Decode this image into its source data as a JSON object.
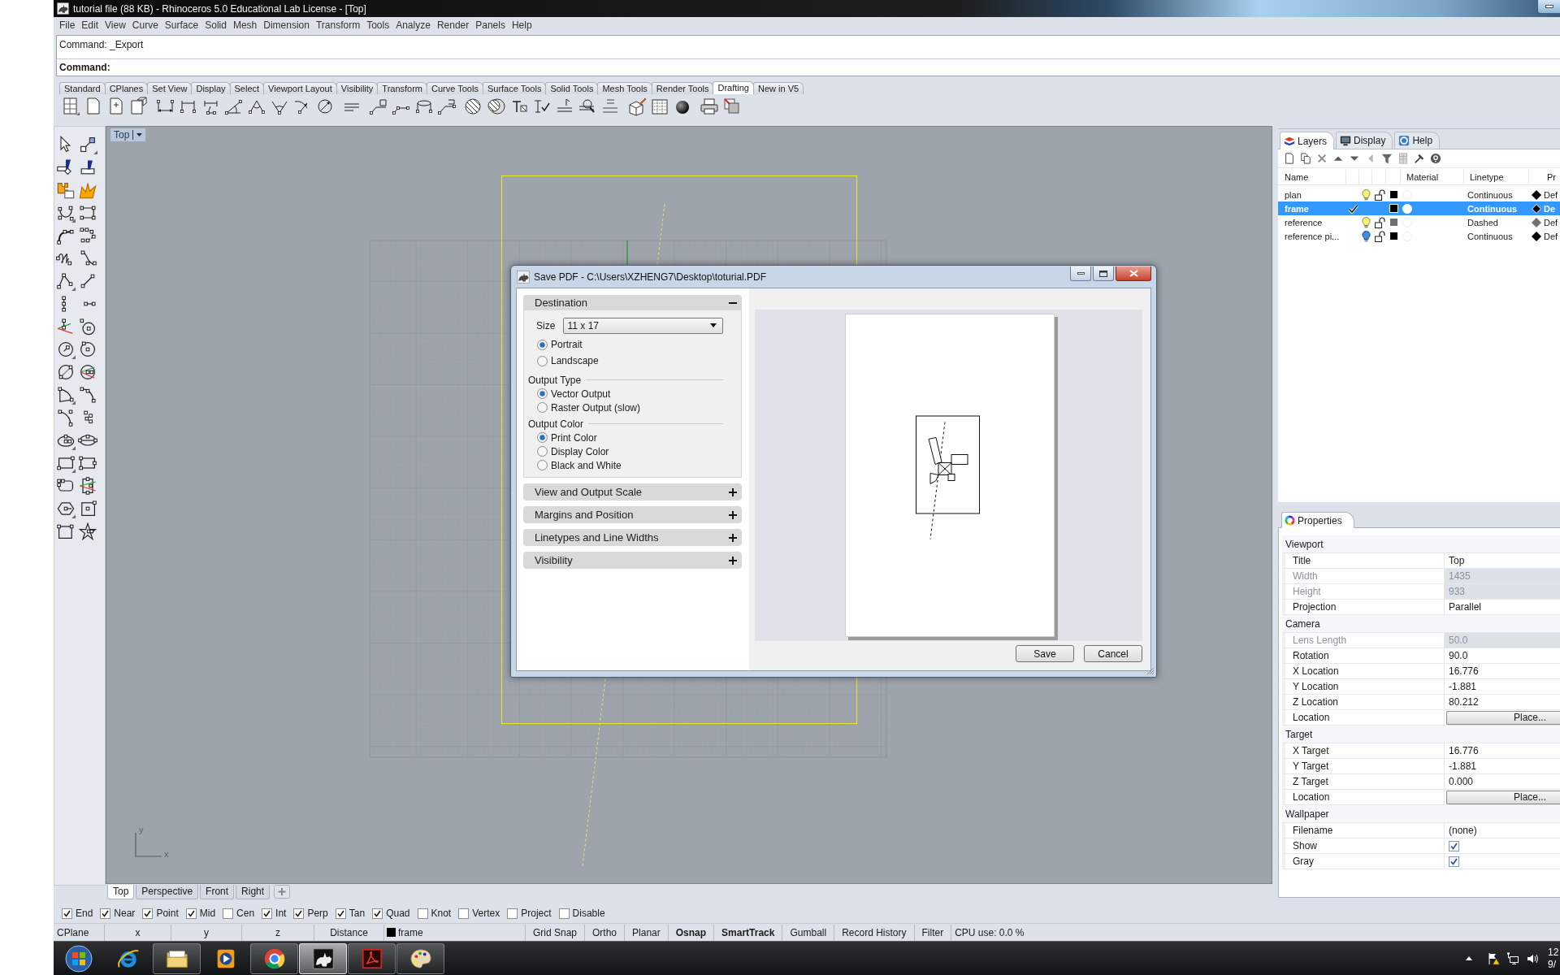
{
  "window": {
    "title": "tutorial file (88 KB) - Rhinoceros 5.0 Educational Lab License - [Top]"
  },
  "menu": [
    "File",
    "Edit",
    "View",
    "Curve",
    "Surface",
    "Solid",
    "Mesh",
    "Dimension",
    "Transform",
    "Tools",
    "Analyze",
    "Render",
    "Panels",
    "Help"
  ],
  "command": {
    "history": "Command: _Export",
    "prompt": "Command:"
  },
  "toolbar_tabs": [
    {
      "label": "Standard",
      "selected": false
    },
    {
      "label": "CPlanes",
      "selected": false
    },
    {
      "label": "Set View",
      "selected": false
    },
    {
      "label": "Display",
      "selected": false
    },
    {
      "label": "Select",
      "selected": false
    },
    {
      "label": "Viewport Layout",
      "selected": false
    },
    {
      "label": "Visibility",
      "selected": false
    },
    {
      "label": "Transform",
      "selected": false
    },
    {
      "label": "Curve Tools",
      "selected": false
    },
    {
      "label": "Surface Tools",
      "selected": false
    },
    {
      "label": "Solid Tools",
      "selected": false
    },
    {
      "label": "Mesh Tools",
      "selected": false
    },
    {
      "label": "Render Tools",
      "selected": false
    },
    {
      "label": "Drafting",
      "selected": true
    },
    {
      "label": "New in V5",
      "selected": false
    }
  ],
  "viewport": {
    "title": "Top",
    "axis_y": "y",
    "axis_x": "x"
  },
  "viewport_tabs": [
    {
      "label": "Top",
      "selected": true
    },
    {
      "label": "Perspective",
      "selected": false
    },
    {
      "label": "Front",
      "selected": false
    },
    {
      "label": "Right",
      "selected": false
    }
  ],
  "osnaps": [
    {
      "label": "End",
      "checked": true
    },
    {
      "label": "Near",
      "checked": true
    },
    {
      "label": "Point",
      "checked": true
    },
    {
      "label": "Mid",
      "checked": true
    },
    {
      "label": "Cen",
      "checked": false
    },
    {
      "label": "Int",
      "checked": true
    },
    {
      "label": "Perp",
      "checked": true
    },
    {
      "label": "Tan",
      "checked": true
    },
    {
      "label": "Quad",
      "checked": true
    },
    {
      "label": "Knot",
      "checked": false
    },
    {
      "label": "Vertex",
      "checked": false
    },
    {
      "label": "Project",
      "checked": false
    },
    {
      "label": "Disable",
      "checked": false
    }
  ],
  "status_bar": {
    "cells": [
      "CPlane",
      "x",
      "y",
      "z",
      "Distance"
    ],
    "layer": {
      "name": "frame",
      "color": "#000000"
    },
    "toggles": [
      {
        "label": "Grid Snap",
        "on": false
      },
      {
        "label": "Ortho",
        "on": false
      },
      {
        "label": "Planar",
        "on": false
      },
      {
        "label": "Osnap",
        "on": true
      },
      {
        "label": "SmartTrack",
        "on": true
      },
      {
        "label": "Gumball",
        "on": false
      },
      {
        "label": "Record History",
        "on": false
      }
    ],
    "filter": "Filter",
    "cpu": "CPU use: 0.0 %"
  },
  "dialog": {
    "title": "Save PDF - C:\\Users\\XZHENG7\\Desktop\\toturial.PDF",
    "sections": [
      {
        "title": "Destination",
        "expanded": true,
        "size": {
          "label": "Size",
          "value": "11 x 17"
        },
        "orientation": [
          {
            "label": "Portrait",
            "selected": true
          },
          {
            "label": "Landscape",
            "selected": false
          }
        ],
        "groups": [
          {
            "title": "Output Type",
            "options": [
              {
                "label": "Vector Output",
                "selected": true
              },
              {
                "label": "Raster Output (slow)",
                "selected": false
              }
            ]
          },
          {
            "title": "Output Color",
            "options": [
              {
                "label": "Print Color",
                "selected": true
              },
              {
                "label": "Display Color",
                "selected": false
              },
              {
                "label": "Black and White",
                "selected": false
              }
            ]
          }
        ]
      },
      {
        "title": "View and Output Scale",
        "expanded": false
      },
      {
        "title": "Margins and Position",
        "expanded": false
      },
      {
        "title": "Linetypes and Line Widths",
        "expanded": false
      },
      {
        "title": "Visibility",
        "expanded": false
      }
    ],
    "buttons": [
      "Save",
      "Cancel"
    ]
  },
  "layers_panel": {
    "tabs": [
      {
        "label": "Layers",
        "selected": true
      },
      {
        "label": "Display",
        "selected": false
      },
      {
        "label": "Help",
        "selected": false
      }
    ],
    "columns": [
      "Name",
      "Material",
      "Linetype",
      "Pr"
    ],
    "rows": [
      {
        "name": "plan",
        "selected": false,
        "current": false,
        "on": true,
        "locked": false,
        "color": "#000000",
        "linetype": "Continuous",
        "diamond": {
          "color": "#000000"
        },
        "column_9": "Def"
      },
      {
        "name": "frame",
        "selected": true,
        "current": true,
        "color": "#000000",
        "linetype": "Continuous",
        "diamond": {
          "color": "#000000"
        },
        "column_9": "De"
      },
      {
        "name": "reference",
        "selected": false,
        "current": false,
        "on": true,
        "locked": false,
        "color": "#707070",
        "linetype": "Dashed",
        "diamond": {
          "color": "#707070"
        },
        "column_9": "Def"
      },
      {
        "name": "reference pi...",
        "selected": false,
        "current": false,
        "on": false,
        "locked": false,
        "color": "#000000",
        "linetype": "Continuous",
        "diamond": {
          "color": "#000000"
        },
        "column_9": "Def"
      }
    ]
  },
  "properties_panel": {
    "tab": "Properties",
    "groups": [
      {
        "title": "Viewport",
        "rows": [
          {
            "label": "Title",
            "value": "Top",
            "kind": "text",
            "disabled": false
          },
          {
            "label": "Width",
            "value": "1435",
            "kind": "text",
            "disabled": true
          },
          {
            "label": "Height",
            "value": "933",
            "kind": "text",
            "disabled": true
          },
          {
            "label": "Projection",
            "value": "Parallel",
            "kind": "text",
            "disabled": false
          }
        ]
      },
      {
        "title": "Camera",
        "rows": [
          {
            "label": "Lens Length",
            "value": "50.0",
            "kind": "text",
            "disabled": true
          },
          {
            "label": "Rotation",
            "value": "90.0",
            "kind": "text",
            "disabled": false
          },
          {
            "label": "X Location",
            "value": "16.776",
            "kind": "text",
            "disabled": false
          },
          {
            "label": "Y Location",
            "value": "-1.881",
            "kind": "text",
            "disabled": false
          },
          {
            "label": "Z Location",
            "value": "80.212",
            "kind": "text",
            "disabled": false
          },
          {
            "label": "Location",
            "value": "Place...",
            "kind": "button",
            "disabled": false
          }
        ]
      },
      {
        "title": "Target",
        "rows": [
          {
            "label": "X Target",
            "value": "16.776",
            "kind": "text",
            "disabled": false
          },
          {
            "label": "Y Target",
            "value": "-1.881",
            "kind": "text",
            "disabled": false
          },
          {
            "label": "Z Target",
            "value": "0.000",
            "kind": "text",
            "disabled": false
          },
          {
            "label": "Location",
            "value": "Place...",
            "kind": "button",
            "disabled": false
          }
        ]
      },
      {
        "title": "Wallpaper",
        "rows": [
          {
            "label": "Filename",
            "value": "(none)",
            "kind": "text",
            "disabled": false
          },
          {
            "label": "Show",
            "kind": "checkbox",
            "checked": true,
            "disabled": false
          },
          {
            "label": "Gray",
            "kind": "checkbox",
            "checked": true,
            "disabled": false
          }
        ]
      }
    ]
  },
  "taskbar": {
    "apps": [
      {
        "running": false,
        "active": false
      },
      {
        "running": true,
        "active": false
      },
      {
        "running": false,
        "active": false
      },
      {
        "running": true,
        "active": false
      },
      {
        "running": true,
        "active": true
      },
      {
        "running": true,
        "active": false
      },
      {
        "running": true,
        "active": false
      }
    ],
    "clock": [
      "12",
      "9/"
    ]
  }
}
